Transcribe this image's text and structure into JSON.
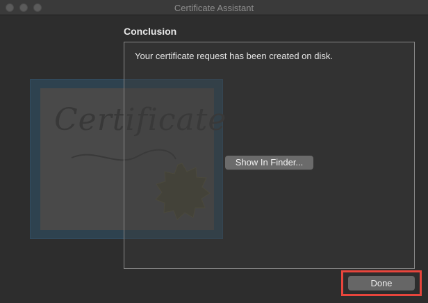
{
  "window": {
    "title": "Certificate Assistant"
  },
  "illustration": {
    "script_text": "Certificate"
  },
  "conclusion": {
    "heading": "Conclusion",
    "message": "Your certificate request has been created on disk.",
    "show_in_finder_label": "Show In Finder..."
  },
  "footer": {
    "done_label": "Done"
  },
  "colors": {
    "highlight": "#e8453c"
  }
}
